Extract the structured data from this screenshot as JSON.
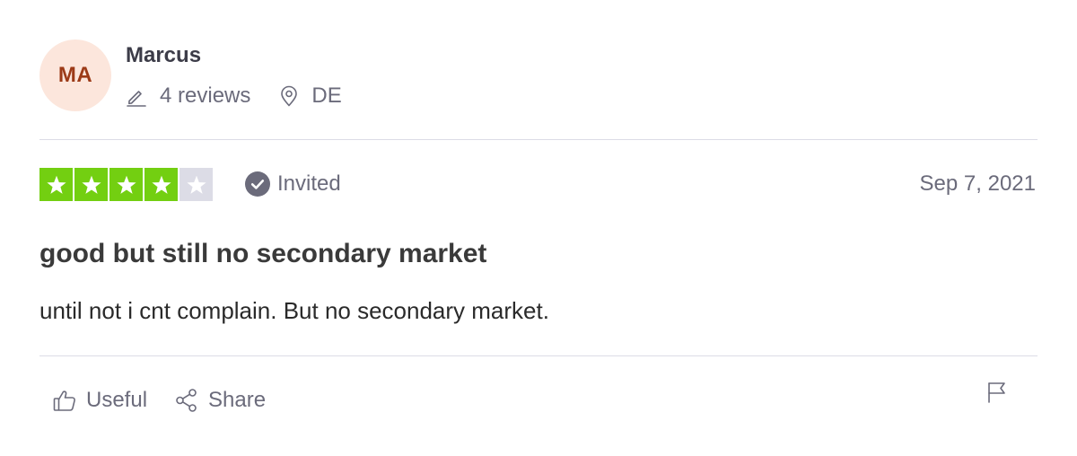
{
  "consumer": {
    "initials": "MA",
    "name": "Marcus",
    "reviews_count": "4 reviews",
    "location": "DE",
    "avatar_bg": "#fce6dc",
    "avatar_fg": "#9c3a17"
  },
  "review": {
    "rating": 4,
    "max_rating": 5,
    "star_color": "#73cf11",
    "verification": "Invited",
    "date": "Sep 7, 2021",
    "title": "good but still no secondary market",
    "text": "until not i cnt complain. But no secondary market."
  },
  "actions": {
    "useful_label": "Useful",
    "share_label": "Share"
  },
  "icons": {
    "reviews": "pencil-icon",
    "location": "location-pin-icon",
    "verification": "check-circle-icon",
    "useful": "thumbs-up-icon",
    "share": "share-icon",
    "report": "flag-icon"
  }
}
